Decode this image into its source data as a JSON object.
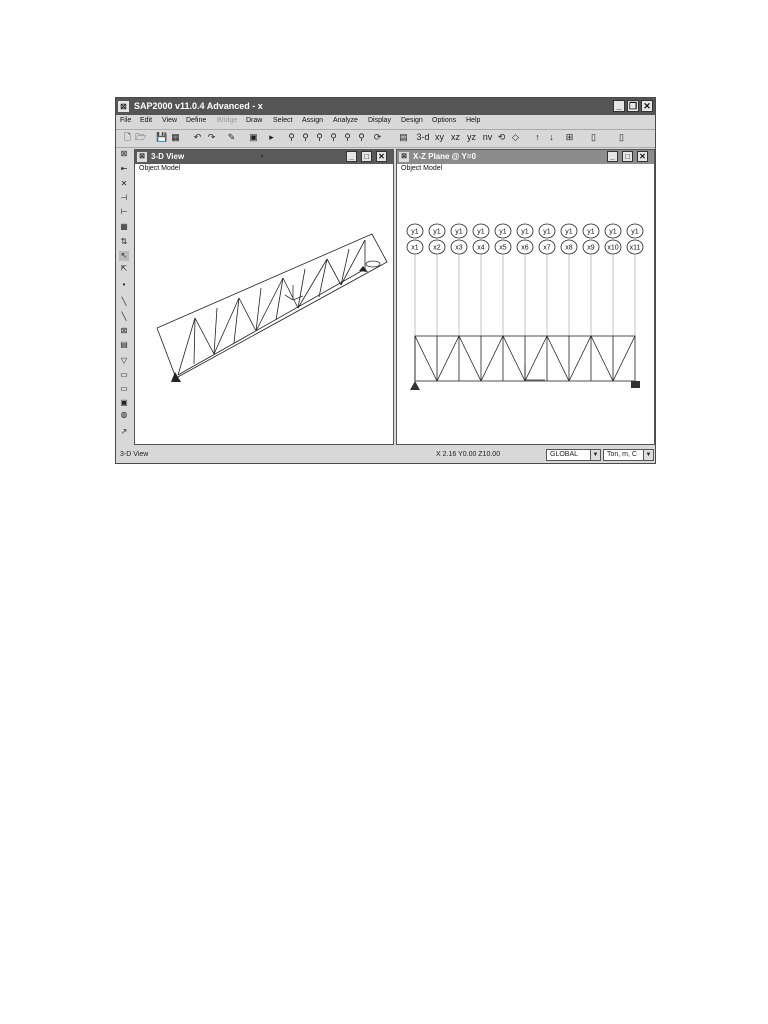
{
  "window": {
    "title": "SAP2000 v11.0.4 Advanced  - x"
  },
  "menu": [
    "File",
    "Edit",
    "View",
    "Define",
    "Bridge",
    "Draw",
    "Select",
    "Assign",
    "Analyze",
    "Display",
    "Design",
    "Options",
    "Help"
  ],
  "menu_disabled": [
    "Bridge"
  ],
  "toolbar": {
    "view_3d": "3-d",
    "view_xy": "xy",
    "view_xz": "xz",
    "view_yz": "yz",
    "view_nv": "nv"
  },
  "left_pane": {
    "title": "3-D View",
    "label": "Object Model"
  },
  "right_pane": {
    "title": "X-Z Plane @ Y=0",
    "label": "Object Model",
    "grid_top": [
      "y1",
      "y1",
      "y1",
      "y1",
      "y1",
      "y1",
      "y1",
      "y1",
      "y1",
      "y1",
      "y1"
    ],
    "grid_bottom": [
      "x1",
      "x2",
      "x3",
      "x4",
      "x5",
      "x6",
      "x7",
      "x8",
      "x9",
      "x10",
      "x11"
    ]
  },
  "status": {
    "view": "3-D View",
    "coords": "X 2.16  Y0.00  Z10.00",
    "coord_system": "GLOBAL",
    "units": "Ton, m, C"
  }
}
